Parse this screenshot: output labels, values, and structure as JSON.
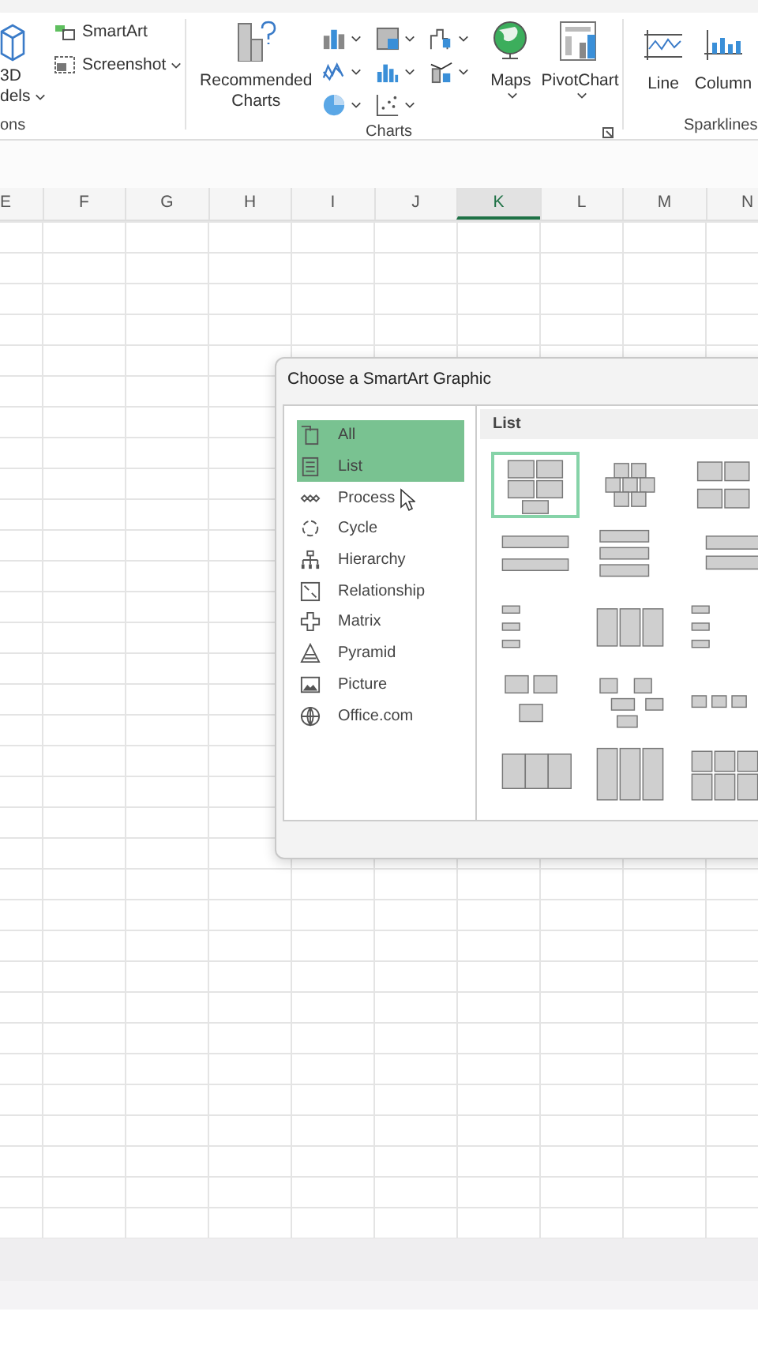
{
  "ribbon": {
    "models_lines": [
      "3D",
      "dels"
    ],
    "smartart": "SmartArt",
    "screenshot": "Screenshot",
    "group_1_label": "ons",
    "recommended_charts": [
      "Recommended",
      "Charts"
    ],
    "maps": "Maps",
    "pivotchart": "PivotChart",
    "charts_label": "Charts",
    "line": "Line",
    "column": "Column",
    "sparklines_label": "Sparklines"
  },
  "columns": [
    {
      "label": "E",
      "selected": false
    },
    {
      "label": "F",
      "selected": false
    },
    {
      "label": "G",
      "selected": false
    },
    {
      "label": "H",
      "selected": false
    },
    {
      "label": "I",
      "selected": false
    },
    {
      "label": "J",
      "selected": false
    },
    {
      "label": "K",
      "selected": true
    },
    {
      "label": "L",
      "selected": false
    },
    {
      "label": "M",
      "selected": false
    },
    {
      "label": "N",
      "selected": false
    }
  ],
  "dialog": {
    "title": "Choose a SmartArt Graphic",
    "categories": [
      {
        "label": "All",
        "selected": true
      },
      {
        "label": "List",
        "selected": true
      },
      {
        "label": "Process",
        "selected": false
      },
      {
        "label": "Cycle",
        "selected": false
      },
      {
        "label": "Hierarchy",
        "selected": false
      },
      {
        "label": "Relationship",
        "selected": false
      },
      {
        "label": "Matrix",
        "selected": false
      },
      {
        "label": "Pyramid",
        "selected": false
      },
      {
        "label": "Picture",
        "selected": false
      },
      {
        "label": "Office.com",
        "selected": false
      }
    ],
    "pane_title": "List",
    "layouts": [
      {
        "selected": true
      },
      {
        "selected": false
      },
      {
        "selected": false
      },
      {
        "selected": false
      },
      {
        "selected": false
      },
      {
        "selected": false
      },
      {
        "selected": false
      },
      {
        "selected": false
      },
      {
        "selected": false
      },
      {
        "selected": false
      },
      {
        "selected": false
      },
      {
        "selected": false
      },
      {
        "selected": false
      },
      {
        "selected": false
      },
      {
        "selected": false
      }
    ]
  }
}
